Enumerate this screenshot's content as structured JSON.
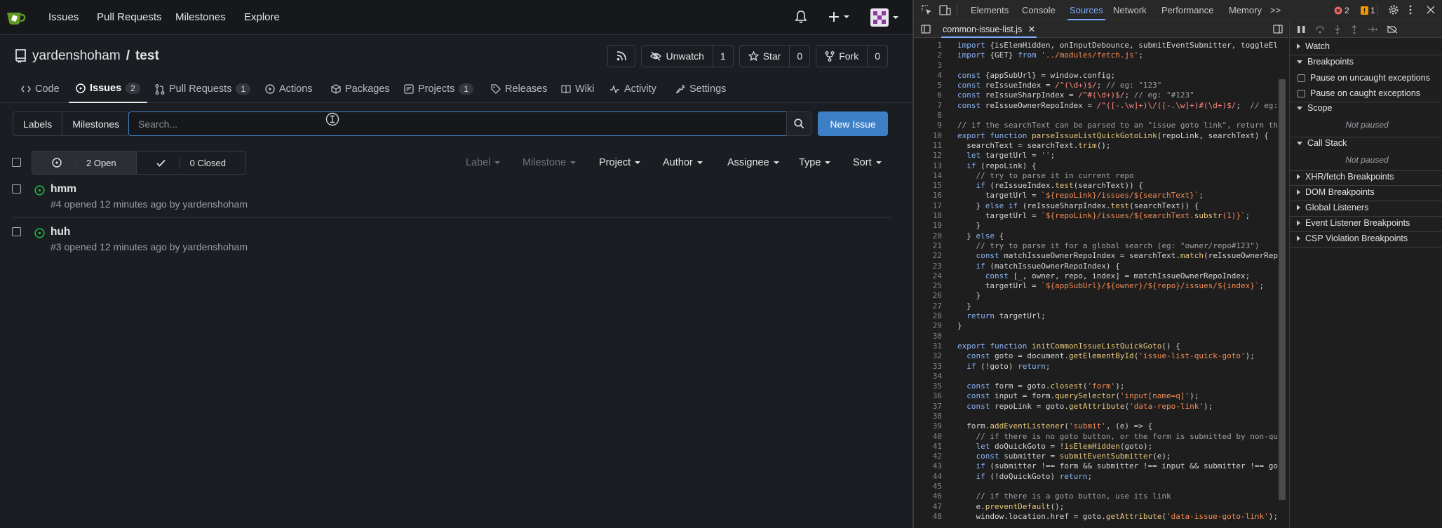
{
  "topnav": {
    "items": [
      "Issues",
      "Pull Requests",
      "Milestones",
      "Explore"
    ]
  },
  "repo": {
    "owner": "yardenshoham",
    "separator": "/",
    "name": "test",
    "unwatch_label": "Unwatch",
    "unwatch_count": "1",
    "star_label": "Star",
    "star_count": "0",
    "fork_label": "Fork",
    "fork_count": "0"
  },
  "tabs": {
    "code": "Code",
    "issues": "Issues",
    "issues_count": "2",
    "pulls": "Pull Requests",
    "pulls_count": "1",
    "actions": "Actions",
    "packages": "Packages",
    "projects": "Projects",
    "projects_count": "1",
    "releases": "Releases",
    "wiki": "Wiki",
    "activity": "Activity",
    "settings": "Settings"
  },
  "filters": {
    "labels": "Labels",
    "milestones": "Milestones",
    "search_placeholder": "Search...",
    "new_issue": "New Issue"
  },
  "list": {
    "open": "2 Open",
    "closed": "0 Closed",
    "label": "Label",
    "milestone": "Milestone",
    "project": "Project",
    "author": "Author",
    "assignee": "Assignee",
    "type": "Type",
    "sort": "Sort",
    "issues": [
      {
        "title": "hmm",
        "meta": "#4 opened 12 minutes ago by yardenshoham"
      },
      {
        "title": "huh",
        "meta": "#3 opened 12 minutes ago by yardenshoham"
      }
    ]
  },
  "devtools": {
    "tabs": [
      "Elements",
      "Console",
      "Sources",
      "Network",
      "Performance",
      "Memory"
    ],
    "more": ">>",
    "errors": "2",
    "warnings": "1",
    "file": "common-issue-list.js",
    "close": "✕",
    "line_numbers": "1\n2\n3\n4\n5\n6\n7\n8\n9\n10\n11\n12\n13\n14\n15\n16\n17\n18\n19\n20\n21\n22\n23\n24\n25\n26\n27\n28\n29\n30\n31\n32\n33\n34\n35\n36\n37\n38\n39\n40\n41\n42\n43\n44\n45\n46\n47\n48",
    "code_lines": [
      "import {isElemHidden, onInputDebounce, submitEventSubmitter, toggleEl",
      "import {GET} from '../modules/fetch.js';",
      "",
      "const {appSubUrl} = window.config;",
      "const reIssueIndex = /^(\\d+)$/; // eg: \"123\"",
      "const reIssueSharpIndex = /^#(\\d+)$/; // eg: \"#123\"",
      "const reIssueOwnerRepoIndex = /^([-.\\w]+)\\/([-.\\w]+)#(\\d+)$/;  // eg:",
      "",
      "// if the searchText can be parsed to an \"issue goto link\", return th",
      "export function parseIssueListQuickGotoLink(repoLink, searchText) {",
      "  searchText = searchText.trim();",
      "  let targetUrl = '';",
      "  if (repoLink) {",
      "    // try to parse it in current repo",
      "    if (reIssueIndex.test(searchText)) {",
      "      targetUrl = `${repoLink}/issues/${searchText}`;",
      "    } else if (reIssueSharpIndex.test(searchText)) {",
      "      targetUrl = `${repoLink}/issues/${searchText.substr(1)}`;",
      "    }",
      "  } else {",
      "    // try to parse it for a global search (eg: \"owner/repo#123\")",
      "    const matchIssueOwnerRepoIndex = searchText.match(reIssueOwnerRep",
      "    if (matchIssueOwnerRepoIndex) {",
      "      const [_, owner, repo, index] = matchIssueOwnerRepoIndex;",
      "      targetUrl = `${appSubUrl}/${owner}/${repo}/issues/${index}`;",
      "    }",
      "  }",
      "  return targetUrl;",
      "}",
      "",
      "export function initCommonIssueListQuickGoto() {",
      "  const goto = document.getElementById('issue-list-quick-goto');",
      "  if (!goto) return;",
      "",
      "  const form = goto.closest('form');",
      "  const input = form.querySelector('input[name=q]');",
      "  const repoLink = goto.getAttribute('data-repo-link');",
      "",
      "  form.addEventListener('submit', (e) => {",
      "    // if there is no goto button, or the form is submitted by non-qu",
      "    let doQuickGoto = !isElemHidden(goto);",
      "    const submitter = submitEventSubmitter(e);",
      "    if (submitter !== form && submitter !== input && submitter !== go",
      "    if (!doQuickGoto) return;",
      "",
      "    // if there is a goto button, use its link",
      "    e.preventDefault();",
      "    window.location.href = goto.getAttribute('data-issue-goto-link');"
    ],
    "debugger": {
      "watch": "Watch",
      "breakpoints": "Breakpoints",
      "pause_uncaught": "Pause on uncaught exceptions",
      "pause_caught": "Pause on caught exceptions",
      "scope": "Scope",
      "not_paused_1": "Not paused",
      "call_stack": "Call Stack",
      "not_paused_2": "Not paused",
      "xhr": "XHR/fetch Breakpoints",
      "dom": "DOM Breakpoints",
      "global": "Global Listeners",
      "event": "Event Listener Breakpoints",
      "csp": "CSP Violation Breakpoints"
    }
  },
  "colors": {
    "accent": "#3d7fc6",
    "open_issue": "#21ba45",
    "devtools_active": "#7cacf8"
  }
}
